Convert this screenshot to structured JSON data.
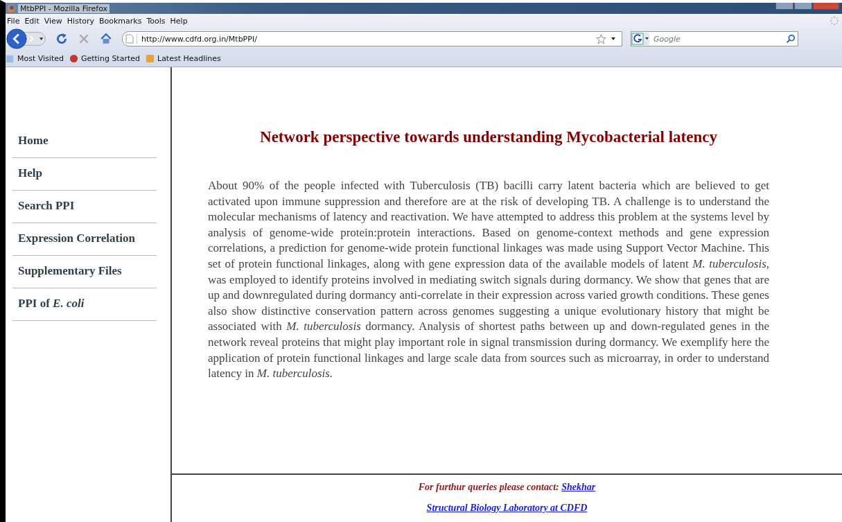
{
  "window": {
    "title": "MtbPPI - Mozilla Firefox"
  },
  "menu": [
    "File",
    "Edit",
    "View",
    "History",
    "Bookmarks",
    "Tools",
    "Help"
  ],
  "address_bar": {
    "value": "http://www.cdfd.org.in/MtbPPI/"
  },
  "search": {
    "placeholder": "Google"
  },
  "bookmarks": [
    "Most Visited",
    "Getting Started",
    "Latest Headlines"
  ],
  "sidebar": {
    "items": [
      {
        "label": "Home"
      },
      {
        "label": "Help"
      },
      {
        "label": "Search PPI"
      },
      {
        "label": "Expression Correlation"
      },
      {
        "label": "Supplementary Files"
      },
      {
        "label": "PPI of *E. coli*"
      }
    ]
  },
  "heading": "Network perspective towards understanding Mycobacterial latency",
  "abstract": "About 90% of the people infected with Tuberculosis (TB) bacilli carry latent bacteria which are believed to get activated upon immune suppression and therefore are at the risk of developing TB. A challenge is to understand the molecular mechanisms of latency and reactivation. We have attempted to address this problem at the systems level by analysis of genome-wide protein:protein interactions. Based on genome-context methods and gene expression correlations, a prediction for genome-wide protein functional linkages was made using Support Vector Machine. This set of protein functional linkages, along with gene expression data of the available models of latent *M. tuberculosis*, was employed to identify proteins involved in mediating switch signals during dormancy. We show that genes that are up and downregulated during dormancy anti-correlate in their expression across varied growth conditions. These genes also show distinctive conservation pattern across genomes suggesting a unique evolutionary history that might be associated with *M. tuberculosis* dormancy. Analysis of shortest paths between up and down-regulated genes in the network reveal proteins that might play important role in signal transmission during dormancy. We exemplify here the application of protein functional linkages and large scale data from sources such as microarray, in order to understand latency in *M. tuberculosis.*",
  "footer": {
    "contact_text": "For furthur queries please contact:",
    "contact_link": "Shekhar",
    "lab_link": "Structural Biology Laboratory at CDFD"
  }
}
